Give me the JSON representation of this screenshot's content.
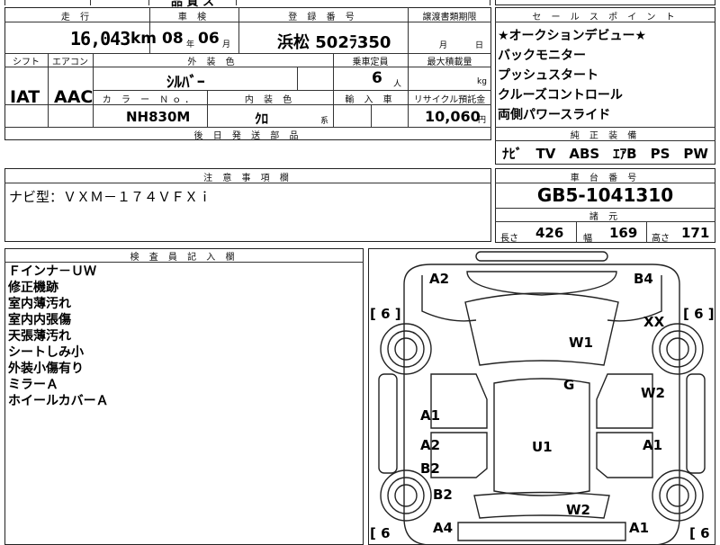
{
  "top_strip": {
    "partial_text": "品 質 ス"
  },
  "header": {
    "labels": {
      "mileage": "走 行",
      "inspection": "車 検",
      "registration": "登 録 番 号",
      "transfer_deadline": "譲渡書類期限",
      "shift": "シフト",
      "aircon": "エアコン",
      "exterior_color": "外 装 色",
      "capacity": "乗車定員",
      "max_load": "最大積載量",
      "color_no": "カ ラ ー Ｎｏ．",
      "interior_color": "内 装 色",
      "import": "輸 入 車",
      "recycle": "リサイクル預託金",
      "later_parts": "後 日 発 送 部 品"
    },
    "mileage_value": "16,043",
    "mileage_unit": "km",
    "inspection_year": "08",
    "inspection_year_unit": "年",
    "inspection_month": "06",
    "inspection_month_unit": "月",
    "registration_value": "浜松 502ﾗ350",
    "deadline_month": "月",
    "deadline_day": "日",
    "shift_value": "IAT",
    "aircon_value": "AAC",
    "exterior_color_value": "ｼﾙﾊﾞｰ",
    "capacity_value": "6",
    "capacity_unit": "人",
    "load_unit": "kg",
    "color_no_value": "NH830M",
    "interior_color_value": "ｸﾛ",
    "interior_suffix": "系",
    "recycle_value": "10,060",
    "recycle_unit": "円"
  },
  "selling_points": {
    "label": "セ ー ル ス ポ イ ン ト",
    "items": [
      "★オークションデビュー★",
      "バックモニター",
      "プッシュスタート",
      "クルーズコントロール",
      "両側パワースライド"
    ]
  },
  "equipment": {
    "label": "純 正 装 備",
    "value": "ﾅﾋﾞ　TV　ABS　ｴｱB　PS　PW"
  },
  "caution": {
    "label": "注 意 事 項 欄",
    "value": "ナビ型：ＶＸＭ－１７４ＶＦＸｉ"
  },
  "chassis": {
    "label": "車 台 番 号",
    "value": "GB5-1041310",
    "dims_label": "諸 元",
    "length_label": "長さ",
    "length": "426",
    "width_label": "幅",
    "width": "169",
    "height_label": "高さ",
    "height": "171"
  },
  "inspector": {
    "label": "検 査 員 記 入 欄",
    "notes": [
      "Ｆインナ－ＵＷ",
      "修正機跡",
      "室内薄汚れ",
      "室内内張傷",
      "天張薄汚れ",
      "シートしみ小",
      "外装小傷有り",
      "ミラーＡ",
      "ホイールカバーＡ"
    ]
  },
  "diagram": {
    "tire_brackets": [
      "[ 6 ]",
      "[ 6 ]",
      "[ 6",
      "[ 6"
    ],
    "marks": [
      "A2",
      "B4",
      "XX",
      "W1",
      "G",
      "W2",
      "A1",
      "A2",
      "B2",
      "U1",
      "A1",
      "B2",
      "A4",
      "W2",
      "A1"
    ]
  }
}
